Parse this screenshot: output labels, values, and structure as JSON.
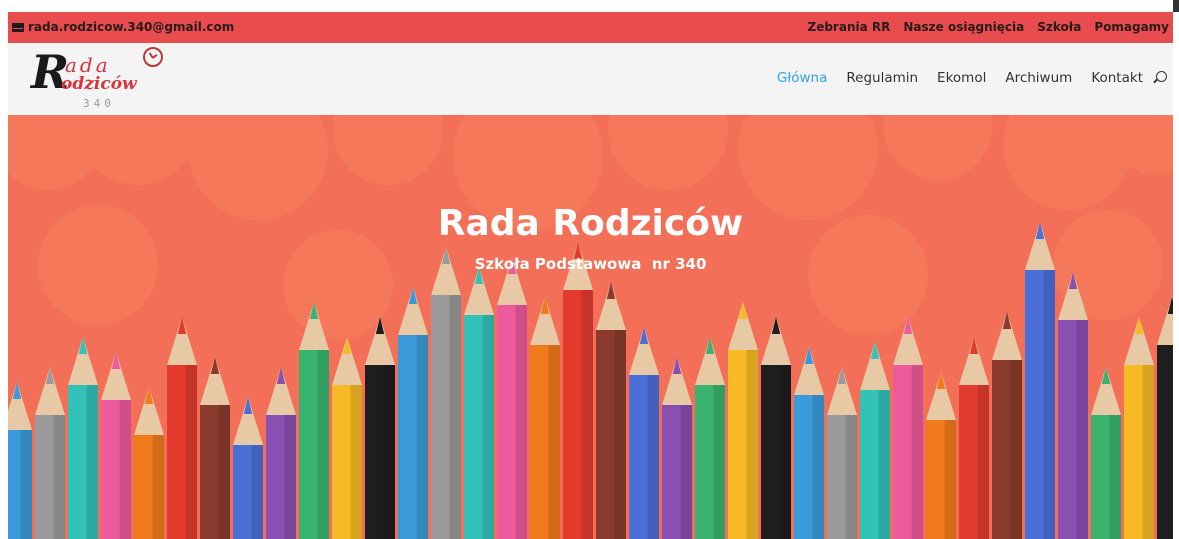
{
  "topbar": {
    "email": "rada.rodzicow.340@gmail.com",
    "links": [
      "Zebrania RR",
      "Nasze osiągnięcia",
      "Szkoła",
      "Pomagamy"
    ]
  },
  "logo": {
    "letter": "R",
    "line1": "ada",
    "line2": "odziców",
    "number": "340"
  },
  "nav": {
    "items": [
      "Główna",
      "Regulamin",
      "Ekomol",
      "Archiwum",
      "Kontakt"
    ],
    "active": "Główna"
  },
  "hero": {
    "title": "Rada Rodziców",
    "subtitle": "Szkoła Podstawowa  nr 340"
  },
  "colors": {
    "topbar": "#e84c4f",
    "hero": "#f36f57",
    "active_nav": "#2ea3f2",
    "logo_red": "#d8343f"
  }
}
